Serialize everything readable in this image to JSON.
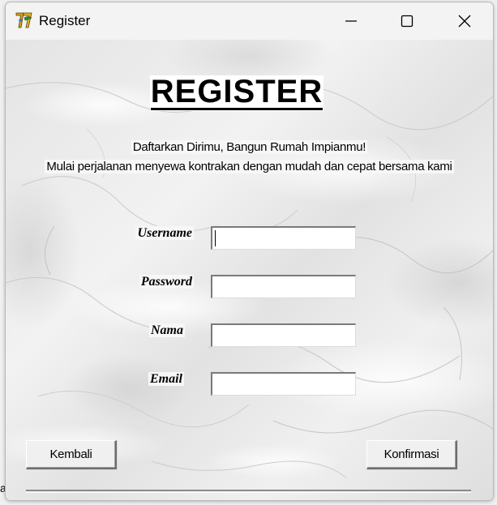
{
  "window": {
    "title": "Register",
    "controls": {
      "minimize": "minimize-icon",
      "maximize": "maximize-icon",
      "close": "close-icon"
    }
  },
  "form": {
    "heading": "REGISTER",
    "subtitle_line1": "Daftarkan Dirimu, Bangun Rumah Impianmu!",
    "subtitle_line2": "Mulai perjalanan menyewa kontrakan dengan mudah dan cepat bersama kami",
    "fields": [
      {
        "label": "Username",
        "value": "",
        "placeholder": ""
      },
      {
        "label": "Password",
        "value": "",
        "placeholder": ""
      },
      {
        "label": "Nama",
        "value": "",
        "placeholder": ""
      },
      {
        "label": "Email",
        "value": "",
        "placeholder": ""
      }
    ],
    "back_button": "Kembali",
    "confirm_button": "Konfirmasi"
  },
  "background": {
    "edge_text": "a"
  },
  "colors": {
    "window_bg": "#f3f3f3",
    "marble_base": "#ececec",
    "text": "#000000"
  }
}
